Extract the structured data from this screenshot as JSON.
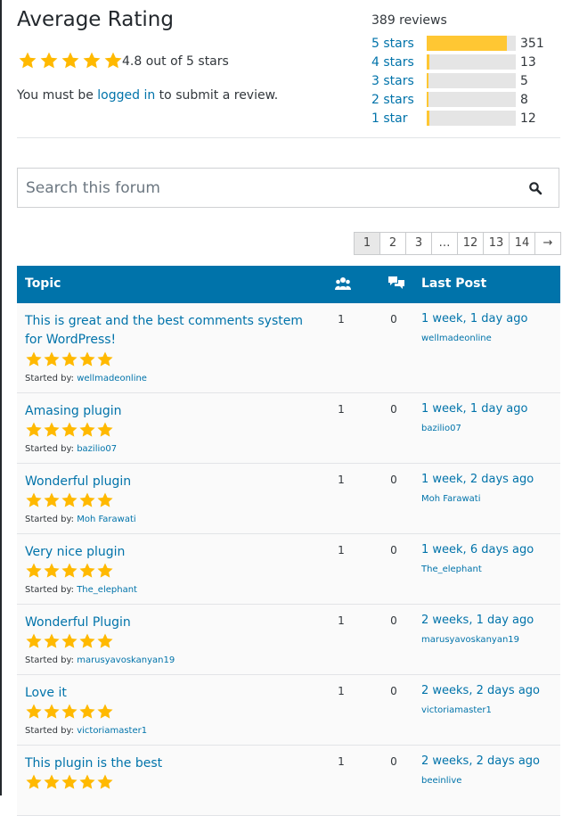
{
  "rating": {
    "title": "Average Rating",
    "stars_filled": 5,
    "average_text": "4.8 out of 5 stars",
    "login_prefix": "You must be ",
    "login_link": "logged in",
    "login_suffix": " to submit a review."
  },
  "reviews": {
    "total_label": "389 reviews",
    "breakdown": [
      {
        "label": "5 stars",
        "count": "351",
        "fill_pct": 90
      },
      {
        "label": "4 stars",
        "count": "13",
        "fill_pct": 3
      },
      {
        "label": "3 stars",
        "count": "5",
        "fill_pct": 1.5
      },
      {
        "label": "2 stars",
        "count": "8",
        "fill_pct": 2
      },
      {
        "label": "1 star",
        "count": "12",
        "fill_pct": 3
      }
    ]
  },
  "search": {
    "placeholder": "Search this forum"
  },
  "pagination": {
    "pages": [
      "1",
      "2",
      "3",
      "…",
      "12",
      "13",
      "14",
      "→"
    ],
    "current": "1"
  },
  "table": {
    "headers": {
      "topic": "Topic",
      "last_post": "Last Post"
    },
    "started_by_label": "Started by: ",
    "rows": [
      {
        "title": "This is great and the best comments system for WordPress!",
        "starter": "wellmadeonline",
        "voices": "1",
        "posts": "0",
        "last_time": "1 week, 1 day ago",
        "last_user": "wellmadeonline",
        "stars": 5
      },
      {
        "title": "Amasing plugin",
        "starter": "bazilio07",
        "voices": "1",
        "posts": "0",
        "last_time": "1 week, 1 day ago",
        "last_user": "bazilio07",
        "stars": 5
      },
      {
        "title": "Wonderful plugin",
        "starter": "Moh Farawati",
        "voices": "1",
        "posts": "0",
        "last_time": "1 week, 2 days ago",
        "last_user": "Moh Farawati",
        "stars": 5
      },
      {
        "title": "Very nice plugin",
        "starter": "The_elephant",
        "voices": "1",
        "posts": "0",
        "last_time": "1 week, 6 days ago",
        "last_user": "The_elephant",
        "stars": 5
      },
      {
        "title": "Wonderful Plugin",
        "starter": "marusyavoskanyan19",
        "voices": "1",
        "posts": "0",
        "last_time": "2 weeks, 1 day ago",
        "last_user": "marusyavoskanyan19",
        "stars": 5
      },
      {
        "title": "Love it",
        "starter": "victoriamaster1",
        "voices": "1",
        "posts": "0",
        "last_time": "2 weeks, 2 days ago",
        "last_user": "victoriamaster1",
        "stars": 5
      },
      {
        "title": "This plugin is the best",
        "starter": "",
        "voices": "1",
        "posts": "0",
        "last_time": "2 weeks, 2 days ago",
        "last_user": "beeinlive",
        "stars": 5
      }
    ]
  },
  "colors": {
    "accent": "#0073aa",
    "star": "#ffb900",
    "bar_fill": "#ffc733",
    "bar_track": "#e5e5e5"
  },
  "icons": {
    "search": "search-icon",
    "voices": "voices-icon",
    "posts": "posts-icon",
    "star": "star-icon"
  }
}
